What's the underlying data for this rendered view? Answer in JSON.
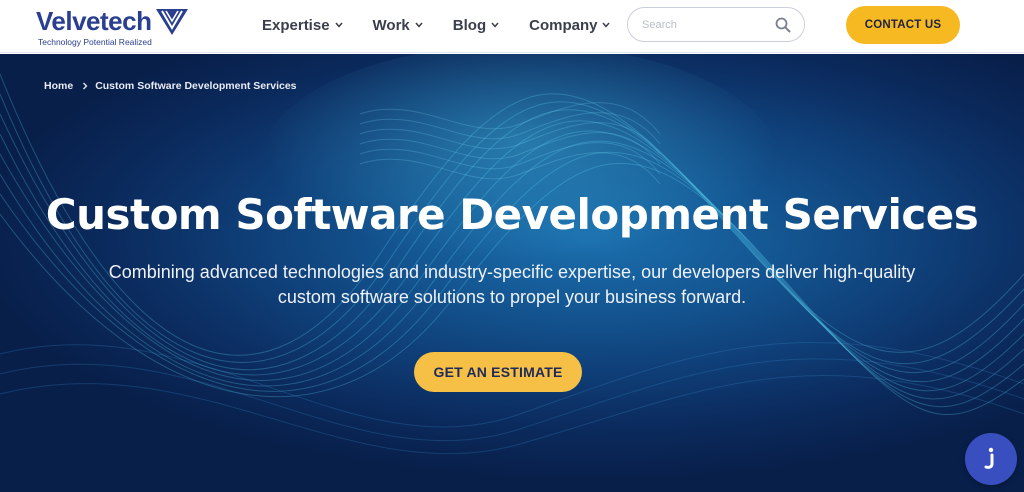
{
  "brand": {
    "name": "Velvetech",
    "tagline": "Technology Potential Realized",
    "color": "#2a3f8f"
  },
  "nav": {
    "items": [
      {
        "label": "Expertise",
        "icon": "chevron-down-icon"
      },
      {
        "label": "Work",
        "icon": "chevron-down-icon"
      },
      {
        "label": "Blog",
        "icon": "chevron-down-icon"
      },
      {
        "label": "Company",
        "icon": "chevron-down-icon"
      }
    ]
  },
  "search": {
    "placeholder": "Search",
    "value": "",
    "icon": "search-icon"
  },
  "header": {
    "contact_label": "CONTACT US"
  },
  "breadcrumb": {
    "home": "Home",
    "current": "Custom Software Development Services"
  },
  "hero": {
    "title": "Custom Software Development Services",
    "subtitle_line1": "Combining advanced technologies and industry-specific expertise, our developers deliver high-quality",
    "subtitle_line2": "custom software solutions to propel your business forward.",
    "cta_label": "GET AN ESTIMATE"
  },
  "colors": {
    "accent": "#f6b921",
    "hero_bg": "#0f3f78",
    "text_dark": "#3b3f4c"
  },
  "chat": {
    "icon": "chat-widget-icon"
  }
}
